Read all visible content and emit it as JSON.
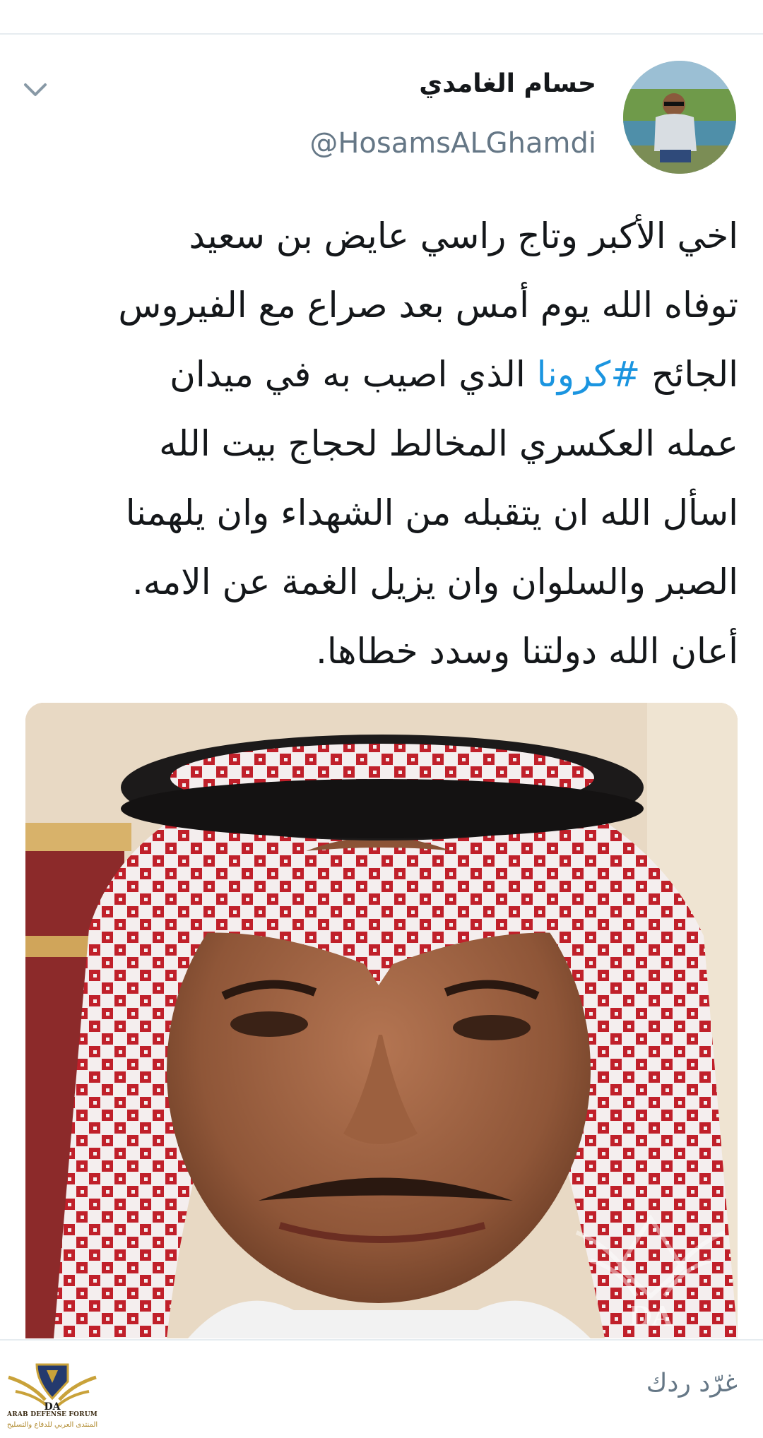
{
  "tweet": {
    "author": {
      "display_name": "حسام الغامدي",
      "handle": "@HosamsALGhamdi"
    },
    "text_lines": [
      {
        "before": "اخي الأكبر وتاج راسي عايض بن سعيد",
        "hashtag": "",
        "after": ""
      },
      {
        "before": "توفاه الله يوم أمس بعد صراع مع الفيروس",
        "hashtag": "",
        "after": ""
      },
      {
        "before": "الجائح ",
        "hashtag": "#كرونا",
        "after": " الذي اصيب به في ميدان"
      },
      {
        "before": "عمله العكسري المخالط لحجاج بيت الله",
        "hashtag": "",
        "after": ""
      },
      {
        "before": "اسأل الله ان يتقبله من الشهداء وان يلهمنا",
        "hashtag": "",
        "after": ""
      },
      {
        "before": "الصبر والسلوان وان يزيل الغمة عن الامه.",
        "hashtag": "",
        "after": ""
      },
      {
        "before": "أعان الله دولتنا وسدد خطاها.",
        "hashtag": "",
        "after": ""
      }
    ],
    "menu_icon": "chevron-down-icon",
    "media_type": "photo"
  },
  "reply": {
    "placeholder": "غرّد ردك"
  },
  "watermark": {
    "text": "DA"
  },
  "forum_logo": {
    "name_en": "ARAB DEFENSE FORUM",
    "name_ar": "المنتدى العربي للدفاع والتسليح",
    "mark": "DA"
  },
  "colors": {
    "text": "#14171a",
    "secondary": "#657786",
    "hashtag": "#1b95e0",
    "divider": "#e6ecf0"
  }
}
